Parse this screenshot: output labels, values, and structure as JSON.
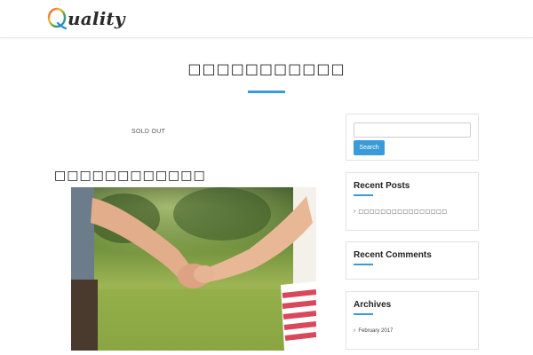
{
  "site": {
    "logo_text": "uality",
    "logo_letter": "Q"
  },
  "page": {
    "title": "□□□□□□□□□□□",
    "sold_out_label": "SOLD OUT",
    "post_title": "□□□□□□□□□□□□"
  },
  "sidebar": {
    "search": {
      "placeholder": "",
      "button_label": "Search"
    },
    "recent_posts": {
      "title": "Recent Posts",
      "items": [
        "□□□□□□□□□□□□□□□□"
      ]
    },
    "recent_comments": {
      "title": "Recent Comments"
    },
    "archives": {
      "title": "Archives",
      "items": [
        "February 2017"
      ]
    }
  },
  "colors": {
    "accent": "#3a9bd9",
    "header_border": "#e6e6e6"
  },
  "icons": {
    "list_bullet": "chevron-right-icon"
  }
}
